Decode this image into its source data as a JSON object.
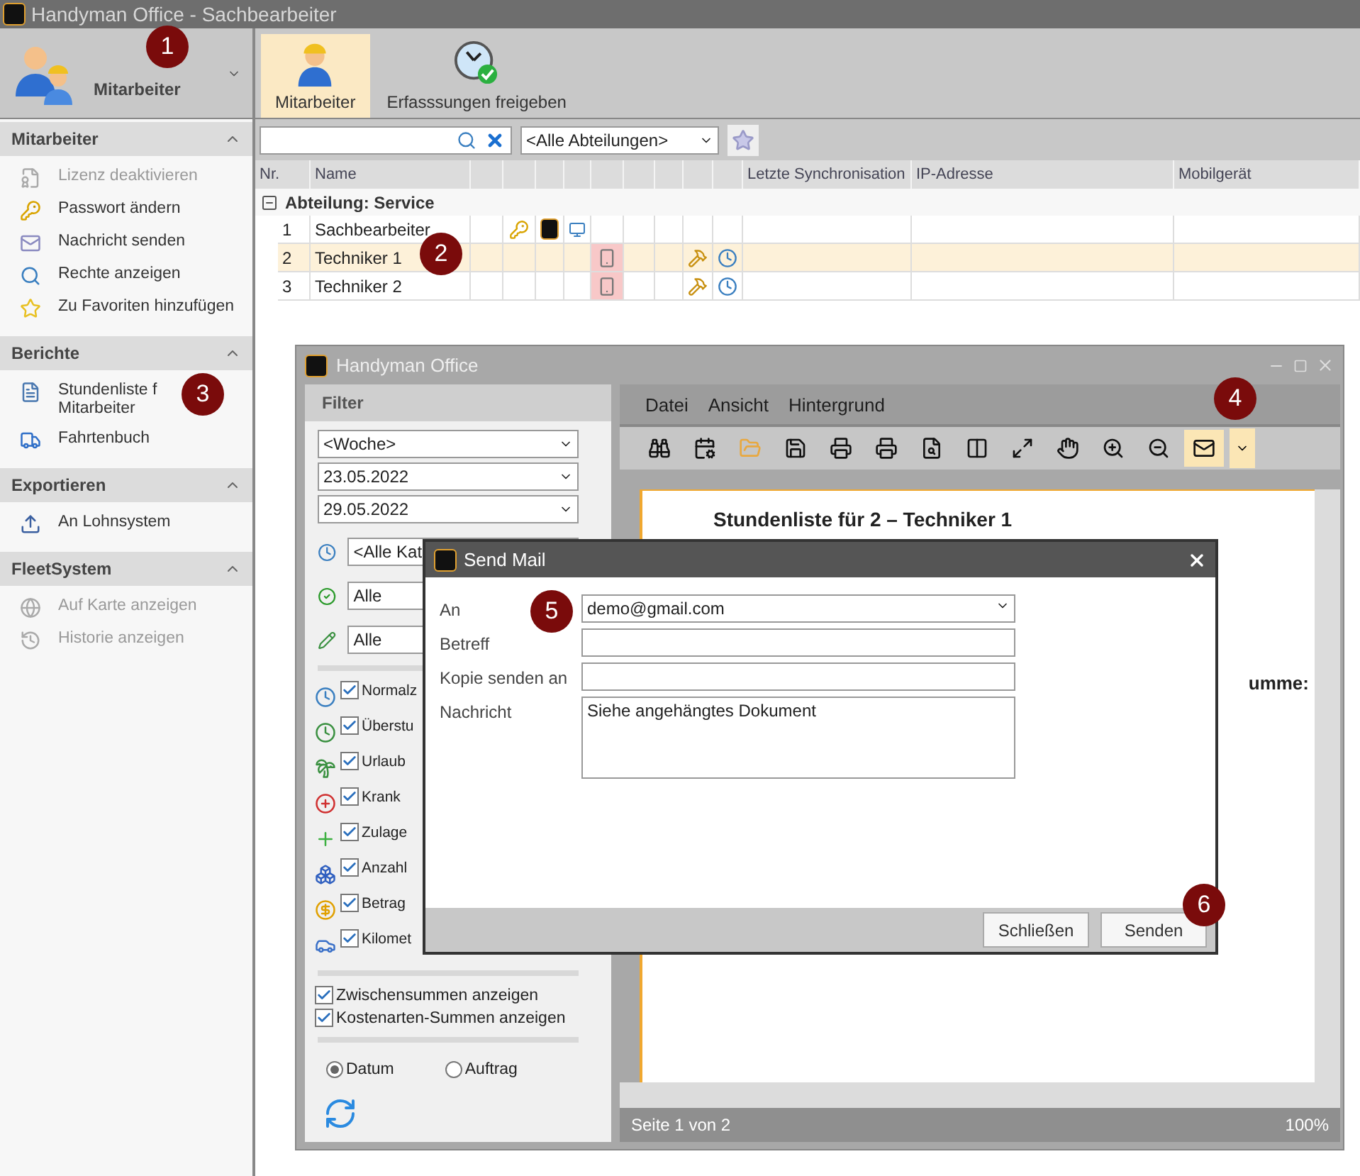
{
  "window": {
    "title": "Handyman Office - Sachbearbeiter"
  },
  "module_selector": {
    "label": "Mitarbeiter"
  },
  "ribbon": [
    {
      "label": "Mitarbeiter",
      "kind": "worker",
      "selected": true
    },
    {
      "label": "Erfasssungen freigeben",
      "kind": "clock",
      "selected": false
    }
  ],
  "sidebar": [
    {
      "title": "Mitarbeiter",
      "items": [
        {
          "lines": [
            "Lizenz deaktivieren"
          ],
          "kind": "license",
          "disabled": true
        },
        {
          "lines": [
            "Passwort ändern"
          ],
          "kind": "key",
          "disabled": false
        },
        {
          "lines": [
            "Nachricht senden"
          ],
          "kind": "mail",
          "disabled": false
        },
        {
          "lines": [
            "Rechte anzeigen"
          ],
          "kind": "search",
          "disabled": false
        },
        {
          "lines": [
            "Zu Favoriten hinzufügen"
          ],
          "kind": "star",
          "disabled": false
        }
      ]
    },
    {
      "title": "Berichte",
      "items": [
        {
          "lines": [
            "Stundenliste f",
            "Mitarbeiter"
          ],
          "kind": "report",
          "disabled": false
        },
        {
          "lines": [
            "Fahrtenbuch"
          ],
          "kind": "car",
          "disabled": false
        }
      ]
    },
    {
      "title": "Exportieren",
      "items": [
        {
          "lines": [
            "An Lohnsystem"
          ],
          "kind": "export",
          "disabled": false
        }
      ]
    },
    {
      "title": "FleetSystem",
      "items": [
        {
          "lines": [
            "Auf Karte anzeigen"
          ],
          "kind": "globe",
          "disabled": true
        },
        {
          "lines": [
            "Historie anzeigen"
          ],
          "kind": "history",
          "disabled": true
        }
      ]
    }
  ],
  "department_filter": {
    "value": "<Alle Abteilungen>"
  },
  "grid": {
    "columns": [
      "Nr.",
      "Name",
      "Letzte Synchronisation",
      "IP-Adresse",
      "Mobilgerät"
    ],
    "group": "Abteilung: Service",
    "rows": [
      {
        "nr": "1",
        "name": "Sachbearbeiter",
        "selected": false,
        "cells": [
          {
            "kind": "none"
          },
          {
            "kind": "key"
          },
          {
            "kind": "hm"
          },
          {
            "kind": "monitor"
          },
          {
            "kind": "none"
          },
          {
            "kind": "none"
          },
          {
            "kind": "none"
          },
          {
            "kind": "none"
          },
          {
            "kind": "none"
          }
        ]
      },
      {
        "nr": "2",
        "name": "Techniker 1",
        "selected": true,
        "cells": [
          {
            "kind": "none"
          },
          {
            "kind": "none"
          },
          {
            "kind": "none"
          },
          {
            "kind": "none"
          },
          {
            "kind": "phone"
          },
          {
            "kind": "none"
          },
          {
            "kind": "none"
          },
          {
            "kind": "hammer"
          },
          {
            "kind": "clock"
          }
        ]
      },
      {
        "nr": "3",
        "name": "Techniker 2",
        "selected": false,
        "cells": [
          {
            "kind": "none"
          },
          {
            "kind": "none"
          },
          {
            "kind": "none"
          },
          {
            "kind": "none"
          },
          {
            "kind": "phone"
          },
          {
            "kind": "none"
          },
          {
            "kind": "none"
          },
          {
            "kind": "hammer"
          },
          {
            "kind": "clock"
          }
        ]
      }
    ]
  },
  "report_window": {
    "title": "Handyman Office",
    "filter": {
      "title": "Filter",
      "dropdowns": [
        "<Woche>",
        "23.05.2022",
        "29.05.2022"
      ],
      "icon_fields": [
        {
          "kind": "clock",
          "value": "<Alle Kat"
        },
        {
          "kind": "check",
          "value": "Alle"
        },
        {
          "kind": "pencil",
          "value": "Alle"
        }
      ],
      "categories": [
        {
          "kind": "clock",
          "label": "Normalz",
          "checked": true
        },
        {
          "kind": "clock-plus",
          "label": "Überstu",
          "checked": true
        },
        {
          "kind": "palm",
          "label": "Urlaub",
          "checked": true
        },
        {
          "kind": "cross",
          "label": "Krank",
          "checked": true
        },
        {
          "kind": "plus",
          "label": "Zulage",
          "checked": true
        },
        {
          "kind": "boxes",
          "label": "Anzahl",
          "checked": true
        },
        {
          "kind": "coin",
          "label": "Betrag",
          "checked": true
        },
        {
          "kind": "car",
          "label": "Kilomet",
          "checked": true
        }
      ],
      "options": [
        {
          "label": "Zwischensummen anzeigen",
          "checked": true
        },
        {
          "label": "Kostenarten-Summen anzeigen",
          "checked": true
        }
      ],
      "sort": [
        {
          "label": "Datum",
          "selected": true
        },
        {
          "label": "Auftrag",
          "selected": false
        }
      ]
    },
    "menu": [
      "Datei",
      "Ansicht",
      "Hintergrund"
    ],
    "toolbar": [
      {
        "kind": "binoculars",
        "selected": false
      },
      {
        "kind": "calendar",
        "selected": false
      },
      {
        "kind": "folder",
        "selected": false
      },
      {
        "kind": "save",
        "selected": false
      },
      {
        "kind": "print",
        "selected": false
      },
      {
        "kind": "print-quick",
        "selected": false
      },
      {
        "kind": "preview",
        "selected": false
      },
      {
        "kind": "layout",
        "selected": false
      },
      {
        "kind": "scale",
        "selected": false
      },
      {
        "kind": "hand",
        "selected": false
      },
      {
        "kind": "zoom-in",
        "selected": false
      },
      {
        "kind": "zoom-out",
        "selected": false
      },
      {
        "kind": "mail",
        "selected": true
      }
    ],
    "document": {
      "heading": "Stundenliste für 2 – Techniker 1",
      "sum_label": "umme:"
    },
    "status": {
      "page": "Seite 1 von 2",
      "zoom": "100%"
    }
  },
  "send_mail": {
    "title": "Send Mail",
    "fields": [
      {
        "label": "An",
        "kind": "dropdown",
        "value": "demo@gmail.com"
      },
      {
        "label": "Betreff",
        "kind": "text"
      },
      {
        "label": "Kopie senden an",
        "kind": "text"
      },
      {
        "label": "Nachricht",
        "kind": "memo",
        "value": "Siehe angehängtes Dokument"
      }
    ],
    "buttons": [
      "Schließen",
      "Senden"
    ]
  },
  "callouts": [
    "1",
    "2",
    "3",
    "4",
    "5",
    "6"
  ]
}
